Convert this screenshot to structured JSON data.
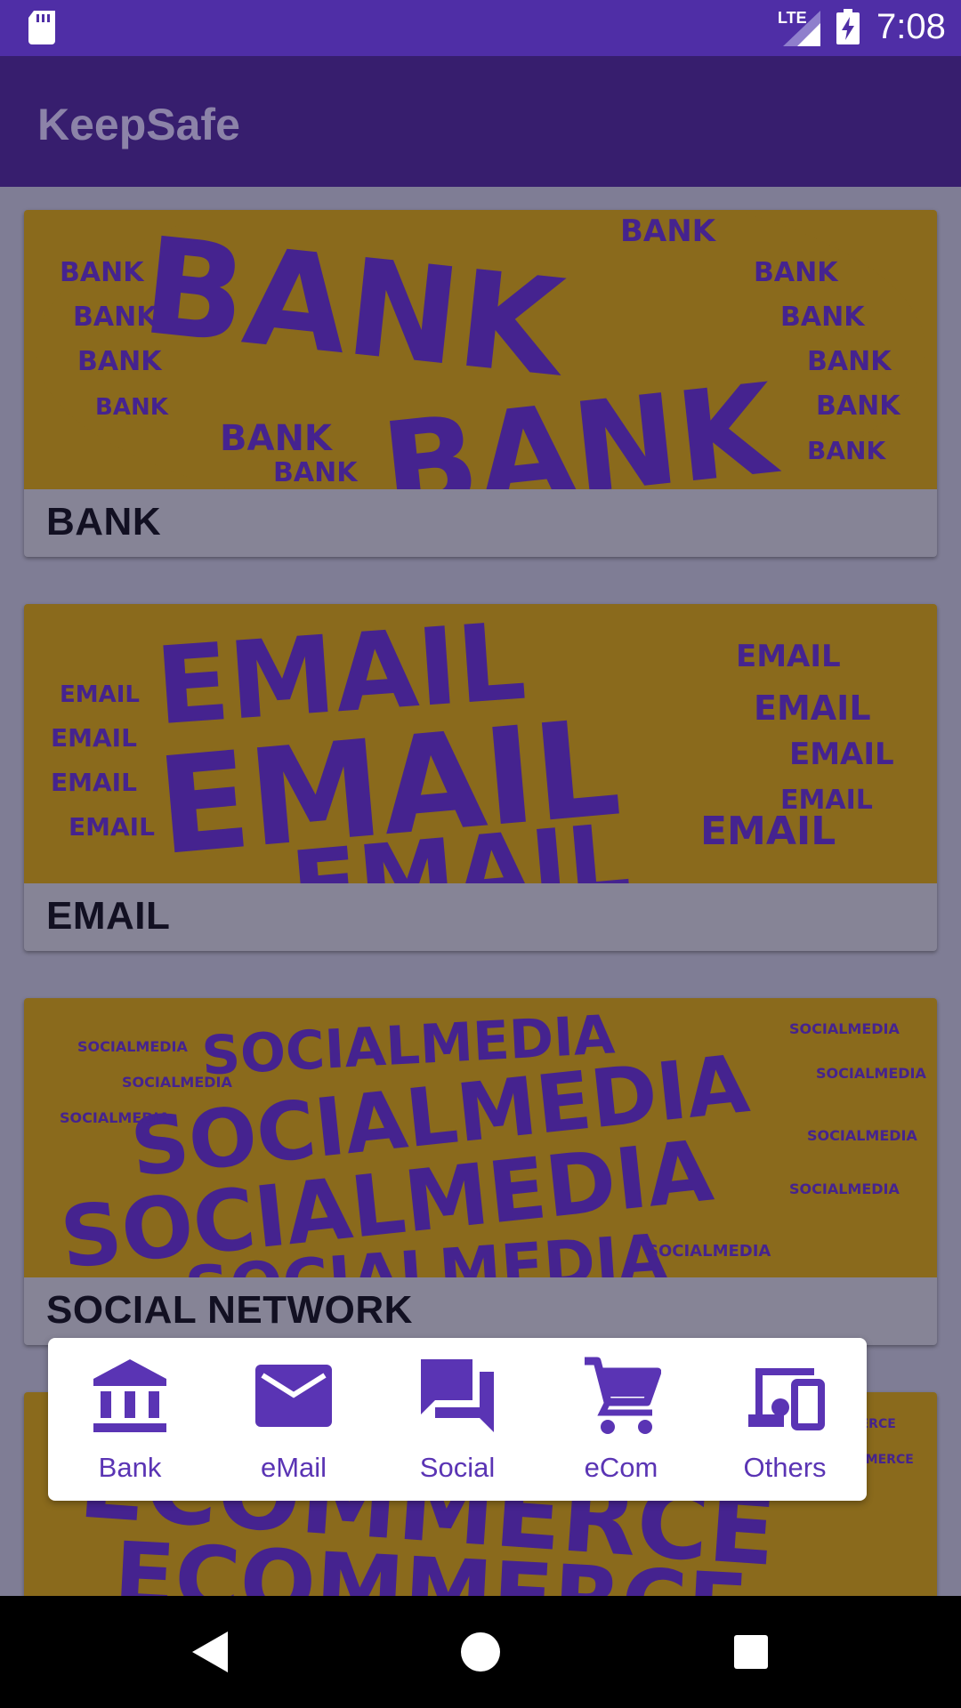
{
  "status_bar": {
    "time": "7:08",
    "network": "LTE",
    "icons": [
      "sd-card-icon",
      "signal-icon",
      "battery-charging-icon"
    ]
  },
  "app_bar": {
    "title": "KeepSafe"
  },
  "categories": [
    {
      "label": "BANK",
      "banner_word": "BANK"
    },
    {
      "label": "EMAIL",
      "banner_word": "EMAIL"
    },
    {
      "label": "SOCIAL NETWORK",
      "banner_word": "SOCIALMEDIA"
    },
    {
      "label": "",
      "banner_word": "ECOMMERCE"
    }
  ],
  "bottom_nav": {
    "items": [
      {
        "label": "Bank",
        "icon": "bank-icon"
      },
      {
        "label": "eMail",
        "icon": "mail-icon"
      },
      {
        "label": "Social",
        "icon": "chat-icon"
      },
      {
        "label": "eCom",
        "icon": "cart-icon"
      },
      {
        "label": "Others",
        "icon": "devices-icon"
      }
    ]
  },
  "system_nav": {
    "icons": [
      "back-icon",
      "home-icon",
      "recents-icon"
    ]
  },
  "colors": {
    "status_bar": "#4f2ea6",
    "app_bar": "#371e6e",
    "banner_bg": "#8a6a1c",
    "banner_text": "#45238f",
    "accent": "#5a34b4"
  }
}
